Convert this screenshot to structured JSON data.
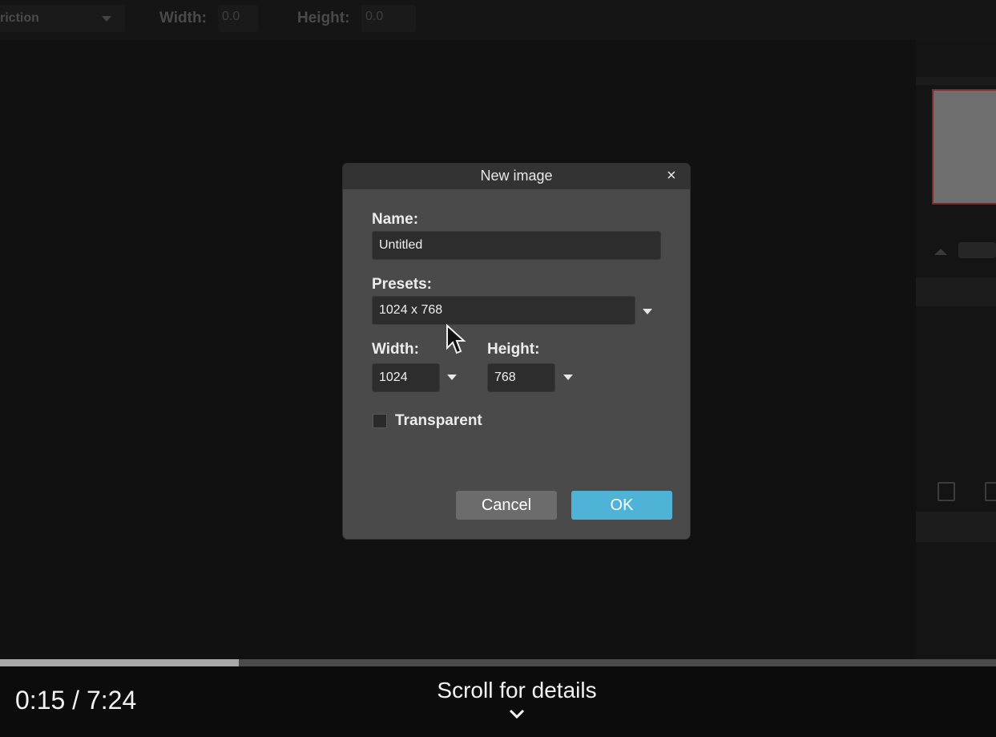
{
  "toolbar": {
    "restriction_label": "riction",
    "width_label": "Width:",
    "width_value": "0.0",
    "height_label": "Height:",
    "height_value": "0.0"
  },
  "dialog": {
    "title": "New image",
    "close_glyph": "×",
    "name_label": "Name:",
    "name_value": "Untitled",
    "presets_label": "Presets:",
    "preset_value": "1024 x 768",
    "width_label": "Width:",
    "width_value": "1024",
    "height_label": "Height:",
    "height_value": "768",
    "transparent_label": "Transparent",
    "transparent_checked": false,
    "cancel_label": "Cancel",
    "ok_label": "OK",
    "ok_color": "#4fb3d8"
  },
  "player": {
    "time": "0:15 / 7:24",
    "scroll_hint": "Scroll for details",
    "progress_fraction": 0.24
  }
}
